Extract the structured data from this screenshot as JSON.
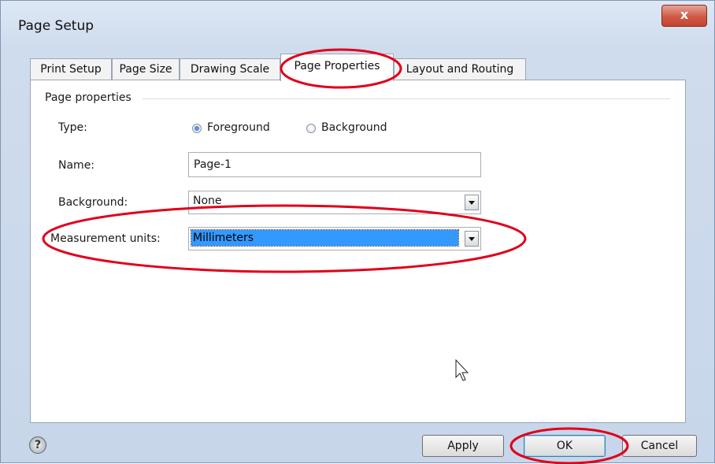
{
  "window": {
    "title": "Page Setup",
    "close_label": "x"
  },
  "tabs": [
    {
      "label": "Print Setup"
    },
    {
      "label": "Page Size"
    },
    {
      "label": "Drawing Scale"
    },
    {
      "label": "Page Properties",
      "active": true
    },
    {
      "label": "Layout and Routing"
    }
  ],
  "page_properties": {
    "group_label": "Page properties",
    "type_label": "Type:",
    "type_options": [
      "Foreground",
      "Background"
    ],
    "type_selected": "Foreground",
    "name_label": "Name:",
    "name_value": "Page-1",
    "background_label": "Background:",
    "background_value": "None",
    "measurement_label": "Measurement units:",
    "measurement_value": "Millimeters"
  },
  "footer": {
    "help_icon": "help-icon",
    "apply_label": "Apply",
    "ok_label": "OK",
    "cancel_label": "Cancel"
  },
  "colors": {
    "annotation": "#e0001a",
    "selection": "#3399ff"
  }
}
